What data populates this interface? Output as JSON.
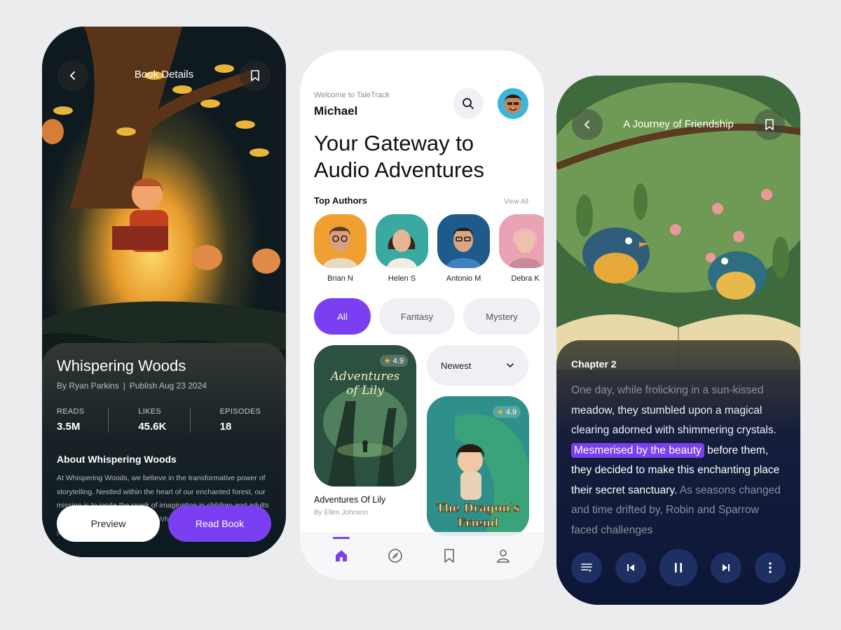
{
  "details": {
    "header_title": "Book Details",
    "book_title": "Whispering Woods",
    "author": "By Ryan Parkins",
    "separator": "|",
    "publish": "Publish Aug 23 2024",
    "stats": [
      {
        "label": "READS",
        "value": "3.5M"
      },
      {
        "label": "LIKES",
        "value": "45.6K"
      },
      {
        "label": "EPISODES",
        "value": "18"
      }
    ],
    "about_heading": "About Whispering Woods",
    "about_text": "At Whispering Woods, we believe in the transformative power of storytelling. Nestled within the heart of our enchanted forest, our mission is to ignite the spark of imagination in children and adults alike through captivating tales. Whispering Woods is more than just a library—it's a gateway to",
    "preview_label": "Preview",
    "read_label": "Read Book",
    "icons": {
      "back": "chevron-left-icon",
      "bookmark": "bookmark-icon"
    }
  },
  "home": {
    "welcome": "Welcome to TaleTrack",
    "user_name": "Michael",
    "headline": "Your Gateway to Audio Adventures",
    "top_authors_label": "Top Authors",
    "view_all": "View All",
    "authors": [
      {
        "name": "Brian N",
        "color": "#f0a030"
      },
      {
        "name": "Helen S",
        "color": "#3aa9a0"
      },
      {
        "name": "Antonio M",
        "color": "#1e5a8c"
      },
      {
        "name": "Debra K",
        "color": "#e9a3b3"
      }
    ],
    "chips": [
      "All",
      "Fantasy",
      "Mystery"
    ],
    "sort_label": "Newest",
    "books": [
      {
        "title": "Adventures Of Lily",
        "author": "By Ellen Johnson",
        "rating": "4.9",
        "cover_text_1": "Adventures",
        "cover_text_2": "of Lily"
      },
      {
        "rating": "4.9",
        "cover_text_1": "The Dragon's",
        "cover_text_2": "Friend"
      }
    ],
    "accent": "#7b3ff2",
    "icons": {
      "search": "search-icon",
      "home": "home-icon",
      "explore": "compass-icon",
      "saved": "bookmark-icon",
      "profile": "user-icon"
    }
  },
  "reader": {
    "header_title": "A Journey of Friendship",
    "chapter": "Chapter 2",
    "text_dim_1": "One day, while frolicking in a sun-kissed",
    "text_mid": "meadow, they stumbled upon a magical clearing adorned with shimmering crystals.",
    "highlight": "Mesmerised by the beauty",
    "text_main": "before them, they decided to make this enchanting place their secret sanctuary.",
    "text_dim_2": "As seasons changed and time drifted by,",
    "text_dim_3": "Robin and Sparrow faced challenges",
    "icons": {
      "list": "playlist-icon",
      "prev": "skip-previous-icon",
      "pause": "pause-icon",
      "next": "skip-next-icon",
      "more": "more-vertical-icon"
    }
  }
}
